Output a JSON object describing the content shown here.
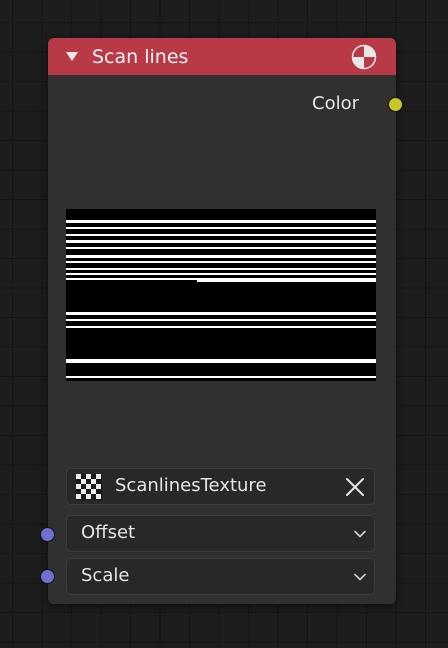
{
  "node": {
    "title": "Scan lines",
    "header_color": "#b83a47",
    "header_icon": "shader-icon",
    "collapse_icon": "triangle-down-icon"
  },
  "outputs": [
    {
      "label": "Color",
      "socket_color": "#c7c729"
    }
  ],
  "preview": {
    "description": "scan lines texture preview",
    "background": "#000000",
    "line_color": "#ffffff"
  },
  "texture": {
    "name": "ScanlinesTexture",
    "icon": "checker-icon",
    "clear_icon": "close-icon"
  },
  "inputs": [
    {
      "label": "Offset",
      "socket_color": "#6f6fd1",
      "icon": "chevron-down-icon"
    },
    {
      "label": "Scale",
      "socket_color": "#6f6fd1",
      "icon": "chevron-down-icon"
    }
  ]
}
